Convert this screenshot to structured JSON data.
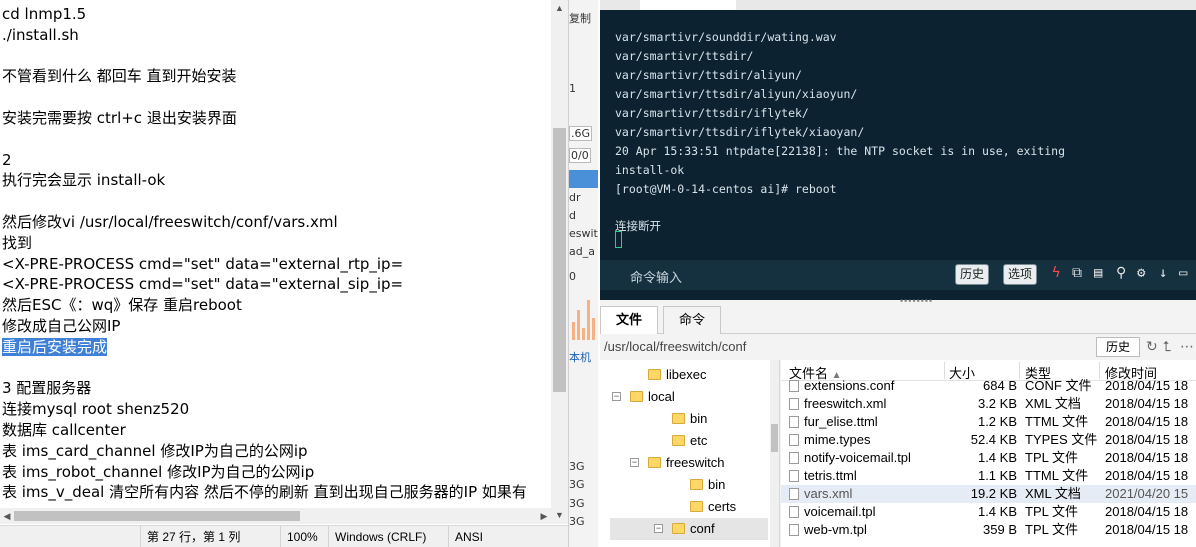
{
  "notepad": {
    "lines": [
      "cd  lnmp1.5",
      "./install.sh",
      "",
      "不管看到什么 都回车 直到开始安装",
      "",
      "安装完需要按 ctrl+c 退出安装界面",
      "",
      "2",
      "执行完会显示  install-ok",
      "",
      "然后修改vi /usr/local/freeswitch/conf/vars.xml",
      "找到",
      "<X-PRE-PROCESS cmd=\"set\" data=\"external_rtp_ip=",
      "<X-PRE-PROCESS cmd=\"set\" data=\"external_sip_ip=",
      "然后ESC《：wq》保存  重启reboot",
      "修改成自己公网IP",
      "重启后安装完成",
      "",
      "3 配置服务器",
      "连接mysql  root shenz520",
      "数据库 callcenter",
      "表 ims_card_channel 修改IP为自己的公网ip",
      "表 ims_robot_channel 修改IP为自己的公网ip",
      "表 ims_v_deal 清空所有内容 然后不停的刷新 直到出现自己服务器的IP 如果有"
    ],
    "selected_line": "重启后安装完成",
    "status": {
      "position": "第 27 行，第 1 列",
      "zoom": "100%",
      "line_ending": "Windows (CRLF)",
      "encoding": "ANSI"
    }
  },
  "strip": {
    "texts": [
      "复制",
      "1",
      ".6G",
      "0/0",
      "dr",
      "d",
      "eswitc",
      "ad_a",
      "0",
      "本机",
      "3G",
      "3G",
      "3G",
      "3G"
    ]
  },
  "terminal": {
    "lines": [
      "var/smartivr/sounddir/wating.wav",
      "var/smartivr/ttsdir/",
      "var/smartivr/ttsdir/aliyun/",
      "var/smartivr/ttsdir/aliyun/xiaoyun/",
      "var/smartivr/ttsdir/iflytek/",
      "var/smartivr/ttsdir/iflytek/xiaoyan/",
      "20 Apr 15:33:51 ntpdate[22138]: the NTP socket is in use, exiting",
      "install-ok",
      "[root@VM-0-14-centos ai]# reboot",
      "",
      "连接断开"
    ],
    "cmd_input_label": "命令输入",
    "history_button": "历史",
    "options_button": "选项"
  },
  "filemanager": {
    "tabs": [
      "文件",
      "命令"
    ],
    "active_tab": "文件",
    "path": "/usr/local/freeswitch/conf",
    "history_button": "历史",
    "tree": [
      {
        "name": "libexec",
        "level": 2,
        "expand": "none"
      },
      {
        "name": "local",
        "level": 1,
        "expand": "minus"
      },
      {
        "name": "bin",
        "level": 3,
        "expand": "none"
      },
      {
        "name": "etc",
        "level": 3,
        "expand": "none"
      },
      {
        "name": "freeswitch",
        "level": 2,
        "expand": "minus"
      },
      {
        "name": "bin",
        "level": 4,
        "expand": "none"
      },
      {
        "name": "certs",
        "level": 4,
        "expand": "none"
      },
      {
        "name": "conf",
        "level": 3,
        "expand": "minus"
      }
    ],
    "columns": [
      "文件名",
      "大小",
      "类型",
      "修改时间"
    ],
    "files": [
      {
        "name": "extensions.conf",
        "size": "684 B",
        "type": "CONF 文件",
        "modified": "2018/04/15 18"
      },
      {
        "name": "freeswitch.xml",
        "size": "3.2 KB",
        "type": "XML 文档",
        "modified": "2018/04/15 18"
      },
      {
        "name": "fur_elise.ttml",
        "size": "1.2 KB",
        "type": "TTML 文件",
        "modified": "2018/04/15 18"
      },
      {
        "name": "mime.types",
        "size": "52.4 KB",
        "type": "TYPES 文件",
        "modified": "2018/04/15 18"
      },
      {
        "name": "notify-voicemail.tpl",
        "size": "1.4 KB",
        "type": "TPL 文件",
        "modified": "2018/04/15 18"
      },
      {
        "name": "tetris.ttml",
        "size": "1.1 KB",
        "type": "TTML 文件",
        "modified": "2018/04/15 18"
      },
      {
        "name": "vars.xml",
        "size": "19.2 KB",
        "type": "XML 文档",
        "modified": "2021/04/20 15"
      },
      {
        "name": "voicemail.tpl",
        "size": "1.4 KB",
        "type": "TPL 文件",
        "modified": "2018/04/15 18"
      },
      {
        "name": "web-vm.tpl",
        "size": "359 B",
        "type": "TPL 文件",
        "modified": "2018/04/15 18"
      }
    ],
    "selected_file": "vars.xml"
  }
}
